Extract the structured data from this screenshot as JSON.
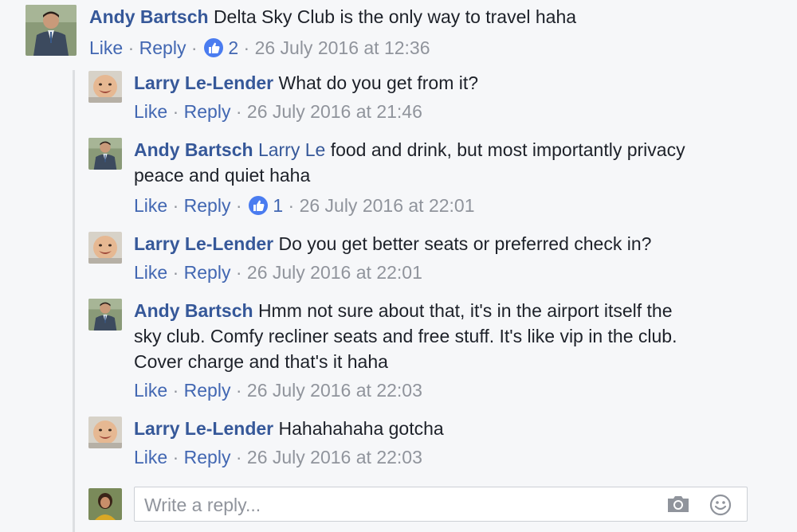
{
  "thread": {
    "top_comment": {
      "author": "Andy Bartsch",
      "text": "Delta Sky Club is the only way to travel haha",
      "like_label": "Like",
      "reply_label": "Reply",
      "like_count": "2",
      "timestamp": "26 July 2016 at 12:36"
    },
    "replies": [
      {
        "author": "Larry Le-Lender",
        "text": "What do you get from it?",
        "like_label": "Like",
        "reply_label": "Reply",
        "timestamp": "26 July 2016 at 21:46"
      },
      {
        "author": "Andy Bartsch",
        "mention": "Larry Le",
        "text_line1": "food and drink, but most importantly privacy",
        "text_line2": "peace and quiet haha",
        "like_label": "Like",
        "reply_label": "Reply",
        "like_count": "1",
        "timestamp": "26 July 2016 at 22:01"
      },
      {
        "author": "Larry Le-Lender",
        "text": "Do you get better seats or preferred check in?",
        "like_label": "Like",
        "reply_label": "Reply",
        "timestamp": "26 July 2016 at 22:01"
      },
      {
        "author": "Andy Bartsch",
        "text_line1": "Hmm not sure about that, it's in the airport itself the",
        "text_line2": "sky club. Comfy recliner seats and free stuff. It's like vip in the club.",
        "text_line3": "Cover charge and that's it haha",
        "like_label": "Like",
        "reply_label": "Reply",
        "timestamp": "26 July 2016 at 22:03"
      },
      {
        "author": "Larry Le-Lender",
        "text": "Hahahahaha gotcha",
        "like_label": "Like",
        "reply_label": "Reply",
        "timestamp": "26 July 2016 at 22:03"
      }
    ],
    "separator": "·"
  },
  "reply_box": {
    "placeholder": "Write a reply...",
    "camera_icon": "camera-icon",
    "emoji_icon": "emoji-icon"
  },
  "colors": {
    "link": "#365899",
    "meta": "#90949c",
    "like_blue": "#4a7cf0",
    "background": "#f6f7f9"
  }
}
